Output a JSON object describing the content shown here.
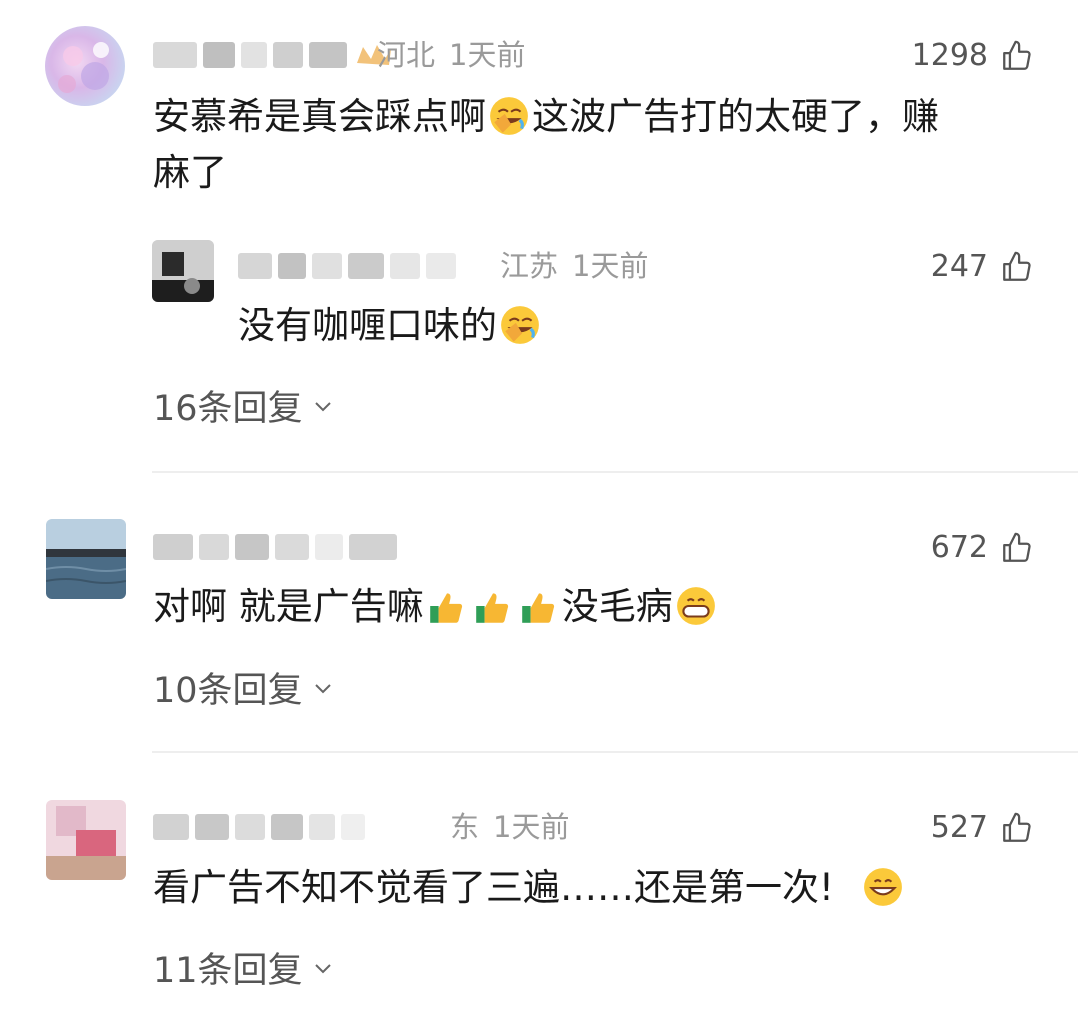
{
  "comments": [
    {
      "location": "河北",
      "time": "1天前",
      "likes": "1298",
      "text_line1": "安慕希是真会踩点啊",
      "text_line1b": "这波广告打的太硬了，赚",
      "text_line2": "麻了",
      "reply": {
        "location": "江苏",
        "time": "1天前",
        "likes": "247",
        "text": "没有咖喱口味的"
      },
      "reply_count": "16条回复"
    },
    {
      "likes": "672",
      "text_a": "对啊 就是广告嘛",
      "text_b": "没毛病",
      "reply_count": "10条回复"
    },
    {
      "location": "东",
      "time": "1天前",
      "likes": "527",
      "text": "看广告不知不觉看了三遍……还是第一次!",
      "reply_count": "11条回复"
    }
  ],
  "icons": {
    "like": "thumbs-up-outline-icon",
    "expand": "chevron-down-icon",
    "emoji_facepalm": "facepalm-laughing-emoji",
    "emoji_thumbsup": "thumbs-up-emoji",
    "emoji_grin": "grinning-emoji"
  },
  "colors": {
    "text": "#1a1a1a",
    "meta": "#9a9a9a",
    "divider": "#eeeeee"
  }
}
